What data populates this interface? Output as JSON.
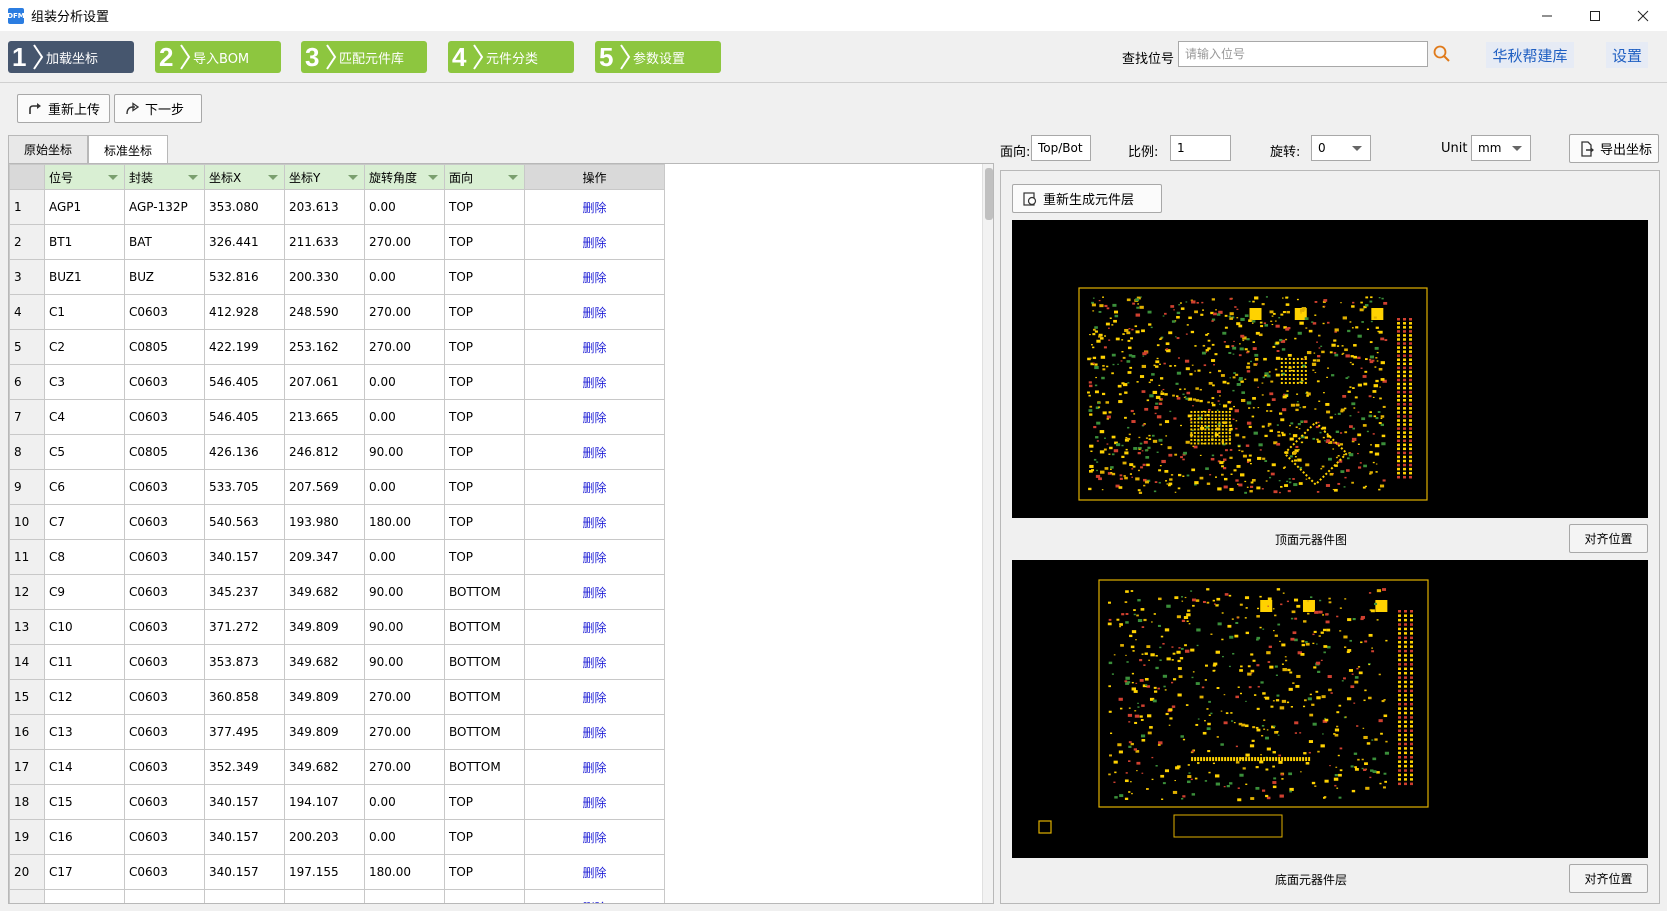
{
  "window": {
    "title": "组装分析设置",
    "app_icon_text": "DFM",
    "controls": [
      "—",
      "☐",
      "✕"
    ]
  },
  "steps": [
    {
      "num": "1",
      "label": "加载坐标",
      "active": true
    },
    {
      "num": "2",
      "label": "导入BOM",
      "active": false
    },
    {
      "num": "3",
      "label": "匹配元件库",
      "active": false
    },
    {
      "num": "4",
      "label": "元件分类",
      "active": false
    },
    {
      "num": "5",
      "label": "参数设置",
      "active": false
    }
  ],
  "search": {
    "label": "查找位号",
    "placeholder": "请输入位号"
  },
  "header_links": {
    "library": "华秋帮建库",
    "settings": "设置"
  },
  "toolbar": {
    "reupload": "重新上传",
    "next": "下一步"
  },
  "tabs": [
    {
      "label": "原始坐标",
      "active": false
    },
    {
      "label": "标准坐标",
      "active": true
    }
  ],
  "table": {
    "columns": [
      "位号",
      "封装",
      "坐标X",
      "坐标Y",
      "旋转角度",
      "面向",
      "操作"
    ],
    "delete_label": "删除",
    "rows": [
      [
        "1",
        "AGP1",
        "AGP-132P",
        "353.080",
        "203.613",
        "0.00",
        "TOP"
      ],
      [
        "2",
        "BT1",
        "BAT",
        "326.441",
        "211.633",
        "270.00",
        "TOP"
      ],
      [
        "3",
        "BUZ1",
        "BUZ",
        "532.816",
        "200.330",
        "0.00",
        "TOP"
      ],
      [
        "4",
        "C1",
        "C0603",
        "412.928",
        "248.590",
        "270.00",
        "TOP"
      ],
      [
        "5",
        "C2",
        "C0805",
        "422.199",
        "253.162",
        "270.00",
        "TOP"
      ],
      [
        "6",
        "C3",
        "C0603",
        "546.405",
        "207.061",
        "0.00",
        "TOP"
      ],
      [
        "7",
        "C4",
        "C0603",
        "546.405",
        "213.665",
        "0.00",
        "TOP"
      ],
      [
        "8",
        "C5",
        "C0805",
        "426.136",
        "246.812",
        "90.00",
        "TOP"
      ],
      [
        "9",
        "C6",
        "C0603",
        "533.705",
        "207.569",
        "0.00",
        "TOP"
      ],
      [
        "10",
        "C7",
        "C0603",
        "540.563",
        "193.980",
        "180.00",
        "TOP"
      ],
      [
        "11",
        "C8",
        "C0603",
        "340.157",
        "209.347",
        "0.00",
        "TOP"
      ],
      [
        "12",
        "C9",
        "C0603",
        "345.237",
        "349.682",
        "90.00",
        "BOTTOM"
      ],
      [
        "13",
        "C10",
        "C0603",
        "371.272",
        "349.809",
        "90.00",
        "BOTTOM"
      ],
      [
        "14",
        "C11",
        "C0603",
        "353.873",
        "349.682",
        "90.00",
        "BOTTOM"
      ],
      [
        "15",
        "C12",
        "C0603",
        "360.858",
        "349.809",
        "270.00",
        "BOTTOM"
      ],
      [
        "16",
        "C13",
        "C0603",
        "377.495",
        "349.809",
        "270.00",
        "BOTTOM"
      ],
      [
        "17",
        "C14",
        "C0603",
        "352.349",
        "349.682",
        "270.00",
        "BOTTOM"
      ],
      [
        "18",
        "C15",
        "C0603",
        "340.157",
        "194.107",
        "0.00",
        "TOP"
      ],
      [
        "19",
        "C16",
        "C0603",
        "340.157",
        "200.203",
        "0.00",
        "TOP"
      ],
      [
        "20",
        "C17",
        "C0603",
        "340.157",
        "197.155",
        "180.00",
        "TOP"
      ]
    ],
    "partial_row_label": "删除"
  },
  "controls": {
    "face_label": "面向:",
    "face_value": "Top/Bot",
    "scale_label": "比例:",
    "scale_value": "1",
    "rotate_label": "旋转:",
    "rotate_value": "0",
    "unit_label": "Unit",
    "unit_value": "mm",
    "export": "导出坐标"
  },
  "views": {
    "regen": "重新生成元件层",
    "top_caption": "顶面元器件图",
    "bottom_caption": "底面元器件层",
    "align_label": "对齐位置"
  },
  "colors": {
    "active_step": "#46566e",
    "step": "#8dc63f",
    "header_green": "#d9efd3",
    "pcb_outline": "#e0b000",
    "pcb_pad": "#ffd200",
    "delete_link": "#1f1fd6"
  }
}
